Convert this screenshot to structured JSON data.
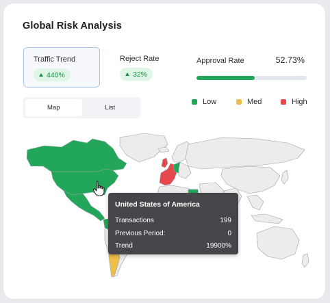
{
  "card": {
    "title": "Global Risk Analysis"
  },
  "kpis": {
    "traffic": {
      "label": "Traffic Trend",
      "value": "440%"
    },
    "reject": {
      "label": "Reject Rate",
      "value": "32%"
    },
    "approval": {
      "label": "Approval Rate",
      "value": "52.73%",
      "progress": 0.5273
    }
  },
  "view_toggle": {
    "options": [
      "Map",
      "List"
    ],
    "selected": "Map"
  },
  "legend": [
    {
      "label": "Low",
      "color": "#22a75a"
    },
    {
      "label": "Med",
      "color": "#eec04a"
    },
    {
      "label": "High",
      "color": "#e5484d"
    }
  ],
  "map": {
    "colors": {
      "none": "#ececec",
      "low": "#22a75a",
      "med": "#eec04a",
      "high": "#e5484d",
      "border": "#9aa0a6"
    }
  },
  "tooltip": {
    "country": "United States of America",
    "rows": [
      {
        "label": "Transactions",
        "value": "199"
      },
      {
        "label": "Previous Period:",
        "value": "0"
      },
      {
        "label": "Trend",
        "value": "19900%"
      }
    ]
  }
}
